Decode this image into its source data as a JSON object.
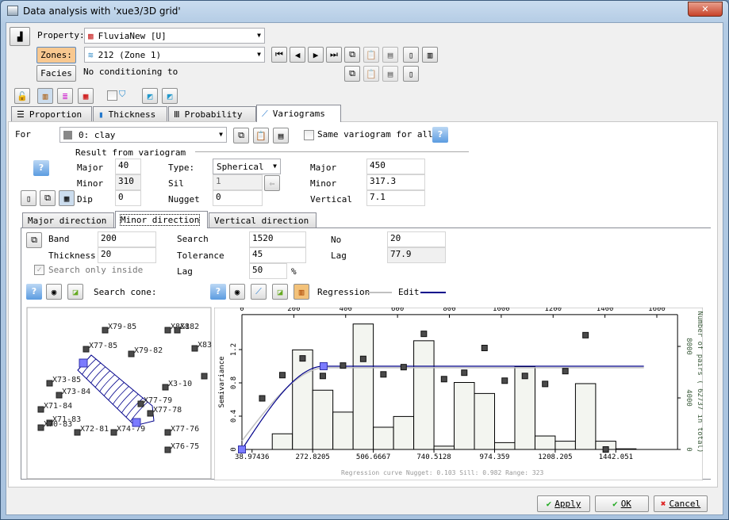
{
  "window": {
    "title": "Data analysis with 'xue3/3D grid'",
    "close": "✕"
  },
  "property": {
    "label": "Property:",
    "value": "FluviaNew [U]"
  },
  "zones": {
    "label": "Zones:",
    "value": "212 (Zone 1)"
  },
  "facies": {
    "label": "Facies",
    "text": "No conditioning to"
  },
  "tabs": [
    {
      "label": "Proportion"
    },
    {
      "label": "Thickness"
    },
    {
      "label": "Probability"
    },
    {
      "label": "Variograms",
      "active": true
    }
  ],
  "for_row": {
    "label": "For",
    "value": "0: clay",
    "same_label": "Same variogram for all",
    "same_checked": false
  },
  "result": {
    "heading": "Result from variogram",
    "major_label": "Major",
    "major": "40",
    "minor_label": "Minor",
    "minor": "310",
    "dip_label": "Dip",
    "dip": "0",
    "type_label": "Type:",
    "type": "Spherical",
    "sill_label": "Sil",
    "sill": "1",
    "nugget_label": "Nugget",
    "nugget": "0",
    "rmajor_label": "Major",
    "rmajor": "450",
    "rminor_label": "Minor",
    "rminor": "317.3",
    "vertical_label": "Vertical",
    "vertical": "7.1"
  },
  "subtabs": [
    {
      "label": "Major direction"
    },
    {
      "label": "Minor direction",
      "active": true
    },
    {
      "label": "Vertical direction"
    }
  ],
  "direction": {
    "band_label": "Band",
    "band": "200",
    "thickness_label": "Thickness",
    "thickness": "20",
    "search_inside_label": "Search only inside",
    "search_inside_checked": true,
    "search_label": "Search",
    "search": "1520",
    "tolerance_label": "Tolerance",
    "tolerance": "45",
    "lag_pct_label": "Lag",
    "lag_pct": "50",
    "pct": "%",
    "no_label": "No",
    "no": "20",
    "lag_label": "Lag",
    "lag": "77.9"
  },
  "search_cone_label": "Search cone:",
  "regression_label": "Regression",
  "edit_label": "Edit",
  "colors": {
    "regression": "#c0c0c0",
    "edit": "#00008b",
    "handle": "#7b7bff",
    "bar_fill": "#f3f5f0",
    "point": "#4a4a4a",
    "zones_button": "#f8c890"
  },
  "wells": [
    {
      "name": "X79-85",
      "x": 132,
      "y": 416
    },
    {
      "name": "X8X882",
      "x": 211,
      "y": 416
    },
    {
      "name": "&1",
      "x": 223,
      "y": 416
    },
    {
      "name": "X77-85",
      "x": 108,
      "y": 440
    },
    {
      "name": "X79-82",
      "x": 165,
      "y": 446
    },
    {
      "name": "X83",
      "x": 245,
      "y": 439
    },
    {
      "name": "",
      "x": 257,
      "y": 474
    },
    {
      "name": "X73-85",
      "x": 62,
      "y": 483
    },
    {
      "name": "X3-10",
      "x": 208,
      "y": 488
    },
    {
      "name": "X73-84",
      "x": 74,
      "y": 498
    },
    {
      "name": "X77-79",
      "x": 177,
      "y": 509
    },
    {
      "name": "X77-78",
      "x": 189,
      "y": 521
    },
    {
      "name": "X71-84",
      "x": 51,
      "y": 516
    },
    {
      "name": "X71-83",
      "x": 62,
      "y": 533
    },
    {
      "name": "X70-83",
      "x": 51,
      "y": 539
    },
    {
      "name": "X72-81",
      "x": 97,
      "y": 545
    },
    {
      "name": "X74-79",
      "x": 143,
      "y": 545
    },
    {
      "name": "X77-76",
      "x": 211,
      "y": 545
    },
    {
      "name": "X76-75",
      "x": 211,
      "y": 567
    }
  ],
  "chart_data": {
    "type": "bar+scatter",
    "xlim": [
      0,
      1680
    ],
    "top_ticks": [
      0,
      200,
      400,
      600,
      800,
      1000,
      1200,
      1400,
      1600
    ],
    "bottom_ticks": [
      "38.97436",
      "272.8205",
      "506.6667",
      "740.5128",
      "974.359",
      "1208.205",
      "1442.051"
    ],
    "bottom_tick_values": [
      38.97436,
      272.8205,
      506.6667,
      740.5128,
      974.359,
      1208.205,
      1442.051
    ],
    "ylabel": "Semivariance",
    "ylim": [
      0,
      1.62
    ],
    "yticks": [
      0,
      0.4,
      0.8,
      1.2
    ],
    "y2label": "Number of pairs   ( 62737 in total)",
    "y2lim": [
      0,
      10460
    ],
    "y2ticks": [
      0,
      4000,
      8000
    ],
    "lag": 77.95,
    "first_edge": 38.97436,
    "pairs": [
      0,
      1215,
      7730,
      4600,
      2900,
      9740,
      1725,
      2560,
      8440,
      255,
      5200,
      4345,
      530,
      6430,
      1045,
      640,
      5110,
      640,
      50
    ],
    "semivariance": [
      null,
      0.614,
      0.893,
      1.094,
      0.883,
      1.008,
      1.088,
      0.902,
      0.989,
      1.389,
      0.845,
      0.922,
      1.219,
      0.826,
      0.883,
      0.787,
      0.941,
      1.373,
      0.0
    ],
    "regression": {
      "model": "spherical",
      "nugget": 0.103,
      "sill": 0.982,
      "range": 323
    },
    "edit": {
      "model": "spherical",
      "nugget": 0,
      "sill": 1,
      "range": 315
    },
    "footer": "Regression curve   Nugget: 0.103   Sill: 0.982   Range: 323"
  },
  "buttons": {
    "apply": "Apply",
    "ok": "OK",
    "cancel": "Cancel"
  }
}
